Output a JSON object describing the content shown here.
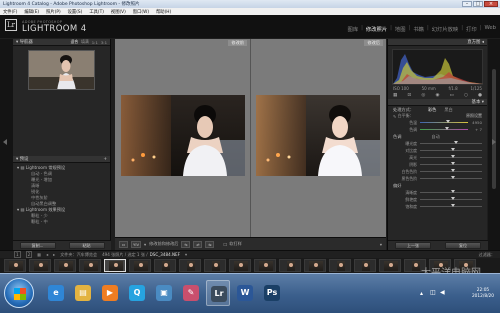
{
  "window": {
    "title": "Lightroom 4 Catalog - Adobe Photoshop Lightroom - 修改照片"
  },
  "menu": [
    "文件(F)",
    "编辑(E)",
    "照片(P)",
    "设置(S)",
    "工具(T)",
    "视图(V)",
    "窗口(W)",
    "帮助(H)"
  ],
  "identity": {
    "subtitle": "ADOBE PHOTOSHOP",
    "name": "LIGHTROOM 4"
  },
  "modules": [
    {
      "label": "图库",
      "active": false
    },
    {
      "label": "修改照片",
      "active": true
    },
    {
      "label": "地图",
      "active": false
    },
    {
      "label": "书籍",
      "active": false
    },
    {
      "label": "幻灯片放映",
      "active": false
    },
    {
      "label": "打印",
      "active": false
    },
    {
      "label": "Web",
      "active": false
    }
  ],
  "navigator": {
    "title": "导航器",
    "zoom_options": [
      "适合",
      "填满",
      "1:1",
      "3:1"
    ]
  },
  "presets": {
    "title": "预设",
    "groups": [
      {
        "label": "Lightroom 常规预设",
        "items": [
          "自动 - 色调",
          "曝光 - 增加",
          "清晰",
          "锐化",
          "中性灰阶",
          "自动黑白调整"
        ]
      },
      {
        "label": "Lightroom 效果预设",
        "items": [
          "颗粒 - 少",
          "颗粒 - 中"
        ]
      }
    ]
  },
  "left_buttons": {
    "copy": "复制...",
    "paste": "粘贴"
  },
  "compare": {
    "before": "修改前",
    "after": "修改后"
  },
  "toolbar": {
    "view_label": "YIV",
    "swap_label": "修改前和修改后",
    "proof_label": "软打样"
  },
  "histogram": {
    "title": "直方图",
    "readouts": [
      "ISO 100",
      "50 mm",
      "f/1.8",
      "1/125"
    ]
  },
  "develop": {
    "treatment_label": "处理方式：",
    "treatment_options": [
      "彩色",
      "黑白"
    ],
    "wb_label": "白平衡：",
    "wb_value": "原照设置",
    "temp_label": "色温",
    "temp_value": "4950",
    "tint_label": "色调",
    "tint_value": "+ 7",
    "tone_label": "色调",
    "tone_auto": "自动",
    "sliders": [
      {
        "label": "曝光度",
        "value": 0.55
      },
      {
        "label": "对比度",
        "value": 0.5
      },
      {
        "label": "高光",
        "value": 0.5
      },
      {
        "label": "阴影",
        "value": 0.5
      },
      {
        "label": "白色色阶",
        "value": 0.5
      },
      {
        "label": "黑色色阶",
        "value": 0.5
      }
    ],
    "presence_label": "偏好",
    "presence_sliders": [
      {
        "label": "清晰度",
        "value": 0.5
      },
      {
        "label": "鲜艳度",
        "value": 0.5
      },
      {
        "label": "饱和度",
        "value": 0.5
      }
    ]
  },
  "right_buttons": {
    "previous": "上一张",
    "reset": "复位"
  },
  "filmstrip": {
    "pages": [
      "1",
      "2"
    ],
    "source": "文件夹：汽车博览会",
    "count": "494 张照片 / 选定 1 张 /",
    "filename": "DSC_3484.NEF",
    "filter_label": "过滤器：",
    "thumbs": [
      {
        "selected": false,
        "vertical": false
      },
      {
        "selected": false,
        "vertical": false
      },
      {
        "selected": false,
        "vertical": false
      },
      {
        "selected": false,
        "vertical": false
      },
      {
        "selected": true,
        "vertical": false
      },
      {
        "selected": false,
        "vertical": false
      },
      {
        "selected": false,
        "vertical": true
      },
      {
        "selected": false,
        "vertical": true
      },
      {
        "selected": false,
        "vertical": true
      },
      {
        "selected": false,
        "vertical": false
      },
      {
        "selected": false,
        "vertical": false
      },
      {
        "selected": false,
        "vertical": true
      },
      {
        "selected": false,
        "vertical": false
      },
      {
        "selected": false,
        "vertical": true
      },
      {
        "selected": false,
        "vertical": true
      },
      {
        "selected": false,
        "vertical": false
      },
      {
        "selected": false,
        "vertical": true
      },
      {
        "selected": false,
        "vertical": false
      },
      {
        "selected": false,
        "vertical": false
      }
    ]
  },
  "taskbar": {
    "apps": [
      {
        "name": "ie-icon",
        "glyph": "e",
        "color": "#2f86d6",
        "active": false
      },
      {
        "name": "folder-icon",
        "glyph": "▤",
        "color": "#e3b341",
        "active": false
      },
      {
        "name": "media-player-icon",
        "glyph": "▶",
        "color": "#ef7d22",
        "active": false
      },
      {
        "name": "qq-icon",
        "glyph": "Q",
        "color": "#26a3e0",
        "active": false
      },
      {
        "name": "photo-viewer-icon",
        "glyph": "▣",
        "color": "#4a8bc2",
        "active": false
      },
      {
        "name": "paint-icon",
        "glyph": "✎",
        "color": "#c94f6d",
        "active": false
      },
      {
        "name": "lightroom-taskbar-icon",
        "glyph": "Lr",
        "color": "#3b4b5c",
        "active": true
      },
      {
        "name": "word-icon",
        "glyph": "W",
        "color": "#2b5797",
        "active": false
      },
      {
        "name": "photoshop-icon",
        "glyph": "Ps",
        "color": "#1a3f66",
        "active": false
      }
    ],
    "clock_time": "22:05",
    "clock_date": "2012/8/20"
  },
  "watermark": "太平洋电脑网"
}
